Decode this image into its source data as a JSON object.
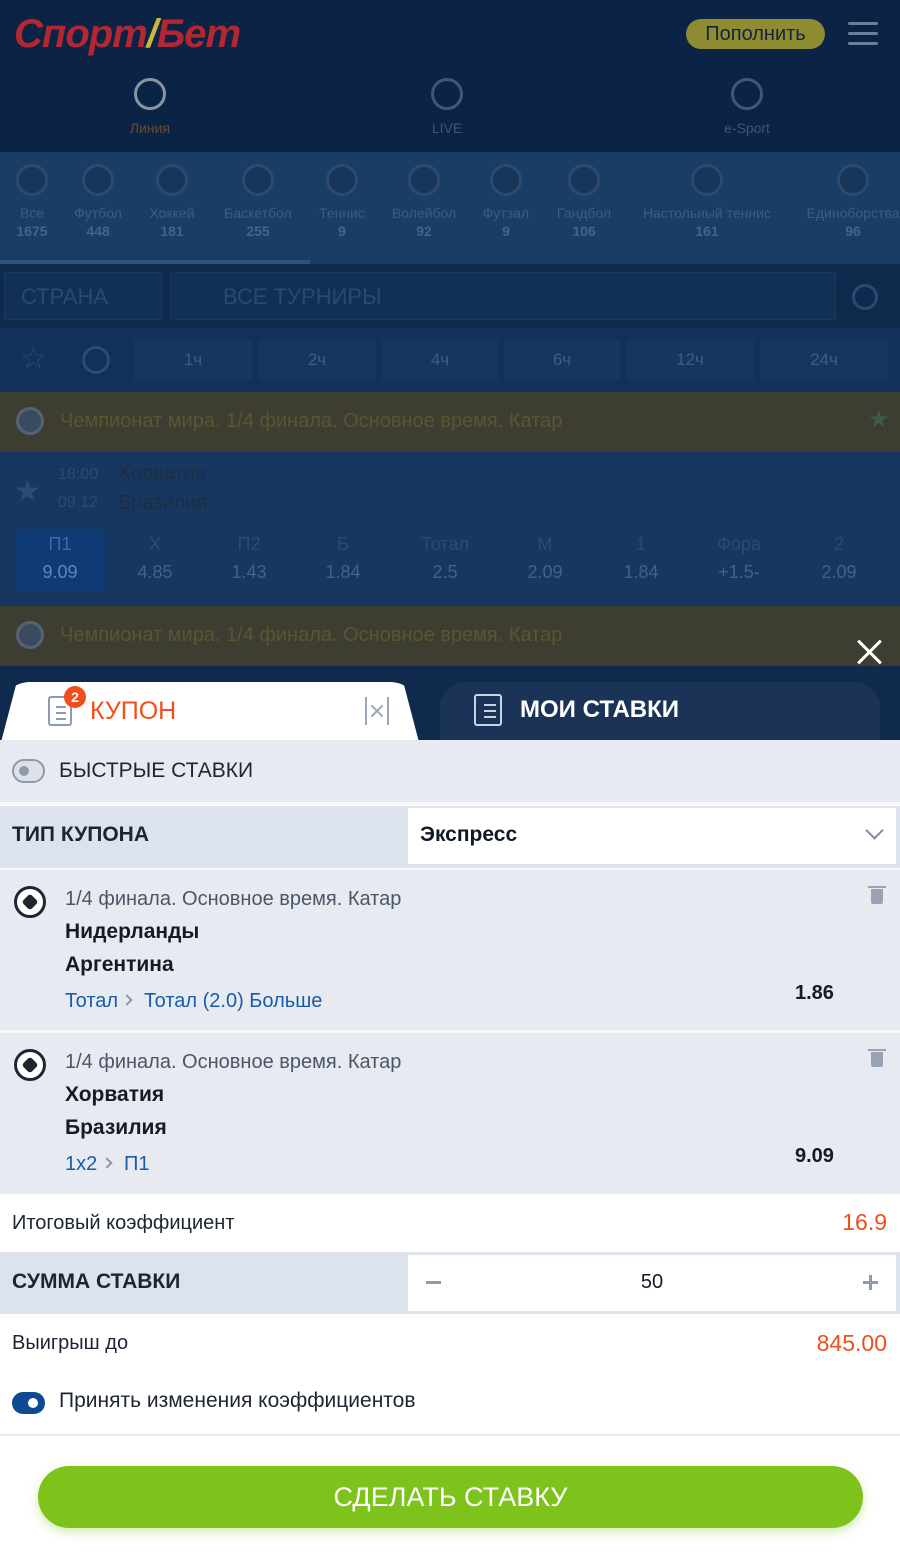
{
  "header": {
    "logo_text": "Спорт",
    "logo_text2": "Бет",
    "topup_label": "Пополнить"
  },
  "modes": [
    {
      "label": "Линия"
    },
    {
      "label": "LIVE"
    },
    {
      "label": "e-Sport"
    }
  ],
  "sports": [
    {
      "label": "Все",
      "count": "1675"
    },
    {
      "label": "Футбол",
      "count": "448"
    },
    {
      "label": "Хоккей",
      "count": "181"
    },
    {
      "label": "Баскетбол",
      "count": "255"
    },
    {
      "label": "Теннис",
      "count": "9"
    },
    {
      "label": "Волейбол",
      "count": "92"
    },
    {
      "label": "Футзал",
      "count": "9"
    },
    {
      "label": "Гандбол",
      "count": "106"
    },
    {
      "label": "Настольный теннис",
      "count": "161"
    },
    {
      "label": "Единоборства",
      "count": "96"
    }
  ],
  "filters": {
    "country": "СТРАНА",
    "tournaments": "ВСЕ ТУРНИРЫ"
  },
  "time_filters": [
    "1ч",
    "2ч",
    "4ч",
    "6ч",
    "12ч",
    "24ч"
  ],
  "league_title": "Чемпионат мира. 1/4 финала. Основное время. Катар",
  "background_match": {
    "time": "18:00",
    "date": "09.12",
    "team1": "Хорватия",
    "team2": "Бразилия",
    "odds": [
      {
        "label": "П1",
        "value": "9.09"
      },
      {
        "label": "Х",
        "value": "4.85"
      },
      {
        "label": "П2",
        "value": "1.43"
      },
      {
        "label": "Б",
        "value": "1.84"
      },
      {
        "label": "Тотал",
        "value": "2.5"
      },
      {
        "label": "М",
        "value": "2.09"
      },
      {
        "label": "1",
        "value": "1.84"
      },
      {
        "label": "Фора",
        "value": "+1.5-"
      },
      {
        "label": "2",
        "value": "2.09"
      }
    ]
  },
  "coupon": {
    "tab_label": "КУПОН",
    "badge_count": "2",
    "my_bets_label": "МОИ СТАВКИ",
    "fast_bets_label": "БЫСТРЫЕ СТАВКИ",
    "type_label": "ТИП КУПОНА",
    "type_value": "Экспресс",
    "bets": [
      {
        "league": "1/4 финала. Основное время. Катар",
        "team1": "Нидерланды",
        "team2": "Аргентина",
        "market": "Тотал",
        "outcome": "Тотал (2.0) Больше",
        "coefficient": "1.86"
      },
      {
        "league": "1/4 финала. Основное время. Катар",
        "team1": "Хорватия",
        "team2": "Бразилия",
        "market": "1x2",
        "outcome": "П1",
        "coefficient": "9.09"
      }
    ],
    "total_coef_label": "Итоговый коэффициент",
    "total_coef_value": "16.9",
    "stake_label": "СУММА СТАВКИ",
    "stake_value": "50",
    "win_label": "Выигрыш до",
    "win_value": "845.00",
    "accept_changes_label": "Принять изменения коэффициентов",
    "fast_bets_enabled": false,
    "accept_changes_enabled": true,
    "submit_label": "СДЕЛАТЬ СТАВКУ"
  },
  "colors": {
    "accent_orange": "#ef4f1c",
    "submit_green": "#7ec21c",
    "link_blue": "#1a5ca8",
    "toggle_blue": "#0e4a92"
  }
}
